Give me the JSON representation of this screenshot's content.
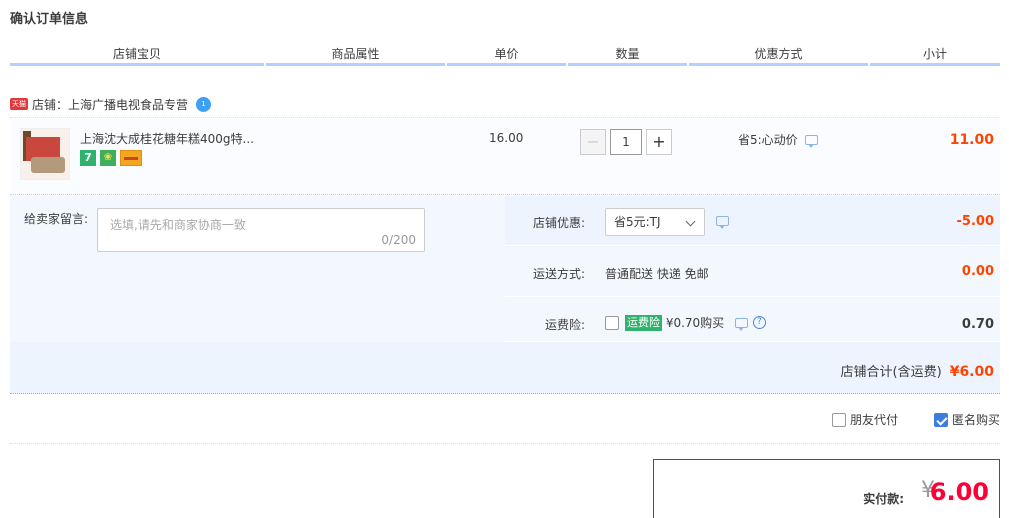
{
  "page_title": "确认订单信息",
  "columns": [
    "店铺宝贝",
    "商品属性",
    "单价",
    "数量",
    "优惠方式",
    "小计"
  ],
  "shop": {
    "badge": "天猫",
    "label": "店铺：上海广播电视食品专营",
    "chat_badge": "1"
  },
  "item": {
    "title": "上海沈大成桂花糖年糕400g特...",
    "service_icons": [
      "7",
      "❀",
      ""
    ],
    "price": "16.00",
    "quantity": "1",
    "minus": "−",
    "plus": "+",
    "discount": "省5:心动价",
    "subtotal": "11.00"
  },
  "memo": {
    "label": "给卖家留言:",
    "placeholder": "选填,请先和商家协商一致",
    "count": "0/200"
  },
  "shop_coupon": {
    "label": "店铺优惠:",
    "selected": "省5元:TJ",
    "amount": "-5.00"
  },
  "shipping": {
    "label": "运送方式:",
    "value": "普通配送 快递 免邮",
    "amount": "0.00"
  },
  "insurance": {
    "label": "运费险:",
    "badge": "运费险",
    "text": "¥0.70购买",
    "help": "?",
    "amount": "0.70"
  },
  "shop_total": {
    "label": "店铺合计(含运费)",
    "amount": "¥6.00"
  },
  "options": {
    "friend_pay": "朋友代付",
    "anonymous": "匿名购买",
    "anonymous_checked": true
  },
  "payment": {
    "label": "实付款:",
    "yen": "¥",
    "amount": "6.00"
  }
}
